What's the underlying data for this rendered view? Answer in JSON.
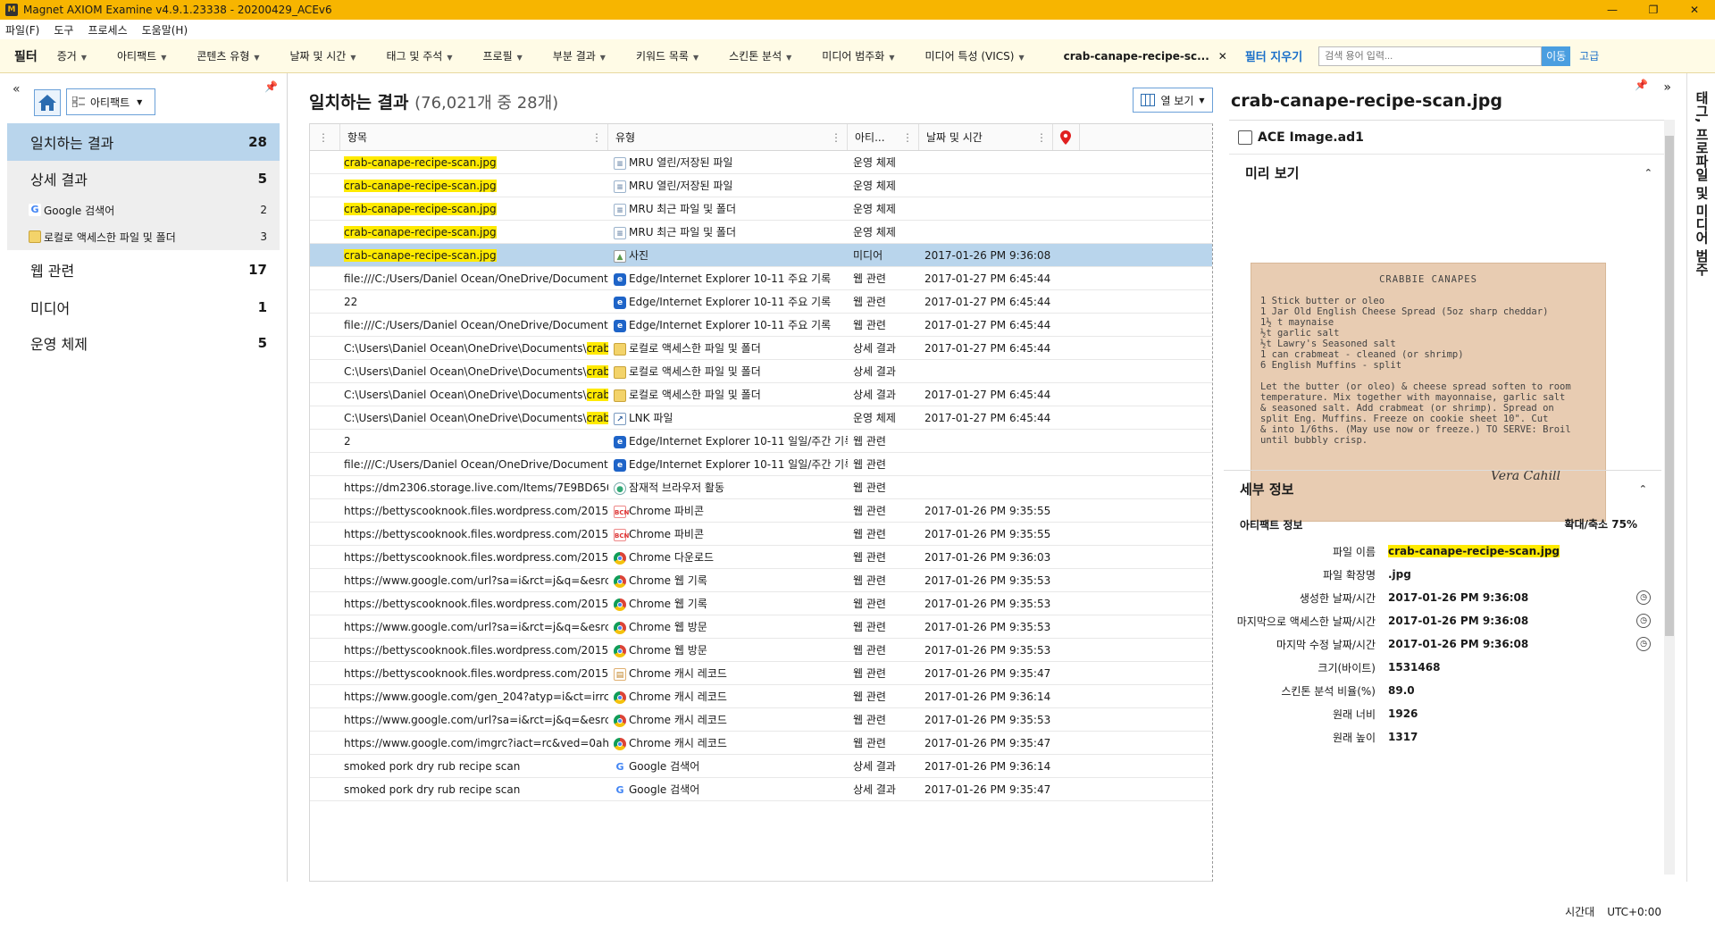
{
  "window": {
    "title": "Magnet AXIOM Examine v4.9.1.23338 - 20200429_ACEv6",
    "buttons": [
      "—",
      "❐",
      "✕"
    ]
  },
  "menu": [
    "파일(F)",
    "도구",
    "프로세스",
    "도움말(H)"
  ],
  "filterbar": {
    "label": "필터",
    "items": [
      "증거",
      "아티팩트",
      "콘텐츠 유형",
      "날짜 및 시간",
      "태그 및 주석",
      "프로필",
      "부분 결과",
      "키워드 목록",
      "스킨톤 분석",
      "미디어 범주화",
      "미디어 특성 (VICS)"
    ],
    "chip": "crab-canape-recipe-sc...",
    "chip_close": "✕",
    "clear": "필터 지우기",
    "search_placeholder": "검색 용어 입력...",
    "go": "이동",
    "advanced": "고급"
  },
  "leftpanel": {
    "collapse": "«",
    "view_select": "아티팩트",
    "nav": [
      {
        "label": "일치하는 결과",
        "count": "28"
      },
      {
        "label": "상세 결과",
        "count": "5"
      },
      {
        "label": "Google 검색어",
        "count": "2"
      },
      {
        "label": "로컬로 액세스한 파일 및 폴더",
        "count": "3"
      },
      {
        "label": "웹 관련",
        "count": "17"
      },
      {
        "label": "미디어",
        "count": "1"
      },
      {
        "label": "운영 체제",
        "count": "5"
      }
    ]
  },
  "grid": {
    "title": "일치하는 결과",
    "subtitle": "(76,021개 중 28개)",
    "column_view": "열 보기",
    "columns": [
      "항목",
      "유형",
      "아티...",
      "날짜 및 시간"
    ],
    "rows": [
      {
        "item": "crab-canape-recipe-scan.jpg",
        "hl": "full",
        "type": "MRU 열린/저장된 파일",
        "icon": "doc",
        "cat": "운영 체제",
        "date": ""
      },
      {
        "item": "crab-canape-recipe-scan.jpg",
        "hl": "full",
        "type": "MRU 열린/저장된 파일",
        "icon": "doc",
        "cat": "운영 체제",
        "date": ""
      },
      {
        "item": "crab-canape-recipe-scan.jpg",
        "hl": "full",
        "type": "MRU 최근 파일 및 폴더",
        "icon": "doc",
        "cat": "운영 체제",
        "date": ""
      },
      {
        "item": "crab-canape-recipe-scan.jpg",
        "hl": "full",
        "type": "MRU 최근 파일 및 폴더",
        "icon": "doc",
        "cat": "운영 체제",
        "date": ""
      },
      {
        "item": "crab-canape-recipe-scan.jpg",
        "hl": "full",
        "type": "사진",
        "icon": "photo",
        "cat": "미디어",
        "date": "2017-01-26 PM 9:36:08",
        "selected": true
      },
      {
        "item": "file:///C:/Users/Daniel Ocean/OneDrive/Documents/...",
        "hl": "none",
        "type": "Edge/Internet Explorer 10-11 주요 기록",
        "icon": "edge",
        "cat": "웹 관련",
        "date": "2017-01-27 PM 6:45:44"
      },
      {
        "item": "22",
        "hl": "none",
        "type": "Edge/Internet Explorer 10-11 주요 기록",
        "icon": "edge",
        "cat": "웹 관련",
        "date": "2017-01-27 PM 6:45:44"
      },
      {
        "item": "file:///C:/Users/Daniel Ocean/OneDrive/Documents/...",
        "hl": "none",
        "type": "Edge/Internet Explorer 10-11 주요 기록",
        "icon": "edge",
        "cat": "웹 관련",
        "date": "2017-01-27 PM 6:45:44"
      },
      {
        "item": "C:\\Users\\Daniel Ocean\\OneDrive\\Documents\\",
        "hl_tail": "crab-c...",
        "hl": "tail",
        "type": "로컬로 액세스한 파일 및 폴더",
        "icon": "folder",
        "cat": "상세 결과",
        "date": "2017-01-27 PM 6:45:44"
      },
      {
        "item": "C:\\Users\\Daniel Ocean\\OneDrive\\Documents\\",
        "hl_tail": "crab-c...",
        "hl": "tail",
        "type": "로컬로 액세스한 파일 및 폴더",
        "icon": "folder",
        "cat": "상세 결과",
        "date": ""
      },
      {
        "item": "C:\\Users\\Daniel Ocean\\OneDrive\\Documents\\",
        "hl_tail": "crab-c...",
        "hl": "tail",
        "type": "로컬로 액세스한 파일 및 폴더",
        "icon": "folder",
        "cat": "상세 결과",
        "date": "2017-01-27 PM 6:45:44"
      },
      {
        "item": "C:\\Users\\Daniel Ocean\\OneDrive\\Documents\\",
        "hl_tail": "crab-c...",
        "hl": "tail",
        "type": "LNK 파일",
        "icon": "lnk",
        "cat": "운영 체제",
        "date": "2017-01-27 PM 6:45:44"
      },
      {
        "item": "2",
        "hl": "none",
        "type": "Edge/Internet Explorer 10-11 일일/주간 기록",
        "icon": "edge",
        "cat": "웹 관련",
        "date": ""
      },
      {
        "item": "file:///C:/Users/Daniel Ocean/OneDrive/Documents/...",
        "hl": "none",
        "type": "Edge/Internet Explorer 10-11 일일/주간 기록",
        "icon": "edge",
        "cat": "웹 관련",
        "date": ""
      },
      {
        "item": "https://dm2306.storage.live.com/Items/7E9BD6500...",
        "hl": "none",
        "type": "잠재적 브라우저 활동",
        "icon": "globe",
        "cat": "웹 관련",
        "date": ""
      },
      {
        "item": "https://bettyscooknook.files.wordpress.com/2015/0...",
        "hl": "none",
        "type": "Chrome 파비콘",
        "icon": "bcn",
        "cat": "웹 관련",
        "date": "2017-01-26 PM 9:35:55"
      },
      {
        "item": "https://bettyscooknook.files.wordpress.com/2015/0...",
        "hl": "none",
        "type": "Chrome 파비콘",
        "icon": "bcn",
        "cat": "웹 관련",
        "date": "2017-01-26 PM 9:35:55"
      },
      {
        "item": "https://bettyscooknook.files.wordpress.com/2015/0...",
        "hl": "none",
        "type": "Chrome 다운로드",
        "icon": "chrome",
        "cat": "웹 관련",
        "date": "2017-01-26 PM 9:36:03"
      },
      {
        "item": "https://www.google.com/url?sa=i&rct=j&q=&esrc=...",
        "hl": "none",
        "type": "Chrome 웹 기록",
        "icon": "chrome",
        "cat": "웹 관련",
        "date": "2017-01-26 PM 9:35:53"
      },
      {
        "item": "https://bettyscooknook.files.wordpress.com/2015/0...",
        "hl": "none",
        "type": "Chrome 웹 기록",
        "icon": "chrome",
        "cat": "웹 관련",
        "date": "2017-01-26 PM 9:35:53"
      },
      {
        "item": "https://www.google.com/url?sa=i&rct=j&q=&esrc=...",
        "hl": "none",
        "type": "Chrome 웹 방문",
        "icon": "chrome",
        "cat": "웹 관련",
        "date": "2017-01-26 PM 9:35:53"
      },
      {
        "item": "https://bettyscooknook.files.wordpress.com/2015/0...",
        "hl": "none",
        "type": "Chrome 웹 방문",
        "icon": "chrome",
        "cat": "웹 관련",
        "date": "2017-01-26 PM 9:35:53"
      },
      {
        "item": "https://bettyscooknook.files.wordpress.com/2015/0...",
        "hl": "none",
        "type": "Chrome 캐시 레코드",
        "icon": "cache",
        "cat": "웹 관련",
        "date": "2017-01-26 PM 9:35:47"
      },
      {
        "item": "https://www.google.com/gen_204?atyp=i&ct=irrclo...",
        "hl": "none",
        "type": "Chrome 캐시 레코드",
        "icon": "chrome",
        "cat": "웹 관련",
        "date": "2017-01-26 PM 9:36:14"
      },
      {
        "item": "https://www.google.com/url?sa=i&rct=j&q=&esrc=...",
        "hl": "none",
        "type": "Chrome 캐시 레코드",
        "icon": "chrome",
        "cat": "웹 관련",
        "date": "2017-01-26 PM 9:35:53"
      },
      {
        "item": "https://www.google.com/imgrc?iact=rc&ved=0ahU...",
        "hl": "none",
        "type": "Chrome 캐시 레코드",
        "icon": "chrome",
        "cat": "웹 관련",
        "date": "2017-01-26 PM 9:35:47"
      },
      {
        "item": "smoked pork dry rub recipe scan",
        "hl": "none",
        "type": "Google 검색어",
        "icon": "google",
        "cat": "상세 결과",
        "date": "2017-01-26 PM 9:36:14"
      },
      {
        "item": "smoked pork dry rub recipe scan",
        "hl": "none",
        "type": "Google 검색어",
        "icon": "google",
        "cat": "상세 결과",
        "date": "2017-01-26 PM 9:35:47"
      }
    ]
  },
  "rightpanel": {
    "title": "crab-canape-recipe-scan.jpg",
    "source": "ACE Image.ad1",
    "preview_label": "미리 보기",
    "zoom": "확대/축소 75%",
    "preview_text": {
      "title": "CRABBIE CANAPES",
      "lines": [
        "1 Stick butter or oleo",
        "1 Jar Old English Cheese Spread (5oz sharp cheddar)",
        "1½ t maynaise",
        "½t garlic salt",
        "½t Lawry's Seasoned salt",
        "1 can crabmeat - cleaned (or shrimp)",
        "6 English Muffins - split",
        "",
        "Let the butter (or oleo) & cheese spread soften to room",
        "temperature.  Mix together with mayonnaise, garlic salt",
        "& seasoned salt.  Add crabmeat (or shrimp).  Spread on",
        "split Eng. Muffins.  Freeze on cookie sheet 10\".  Cut",
        "& into 1/6ths. (May use now or freeze.)  TO SERVE:  Broil",
        "until bubbly crisp."
      ],
      "signature": "Vera Cahill"
    },
    "details_label": "세부 정보",
    "artifact_info": "아티팩트 정보",
    "details": [
      {
        "k": "파일 이름",
        "v": "crab-canape-recipe-scan.jpg",
        "hl": true
      },
      {
        "k": "파일 확장명",
        "v": ".jpg"
      },
      {
        "k": "생성한 날짜/시간",
        "v": "2017-01-26 PM 9:36:08",
        "clock": true
      },
      {
        "k": "마지막으로 액세스한 날짜/시간",
        "v": "2017-01-26 PM 9:36:08",
        "clock": true
      },
      {
        "k": "마지막 수정 날짜/시간",
        "v": "2017-01-26 PM 9:36:08",
        "clock": true
      },
      {
        "k": "크기(바이트)",
        "v": "1531468"
      },
      {
        "k": "스킨톤 분석 비율(%)",
        "v": "89.0"
      },
      {
        "k": "원래 너비",
        "v": "1926"
      },
      {
        "k": "원래 높이",
        "v": "1317"
      }
    ]
  },
  "sidetab": "태그, 프로파일 및 미디어 범주",
  "statusbar": {
    "label": "시간대",
    "value": "UTC+0:00"
  }
}
